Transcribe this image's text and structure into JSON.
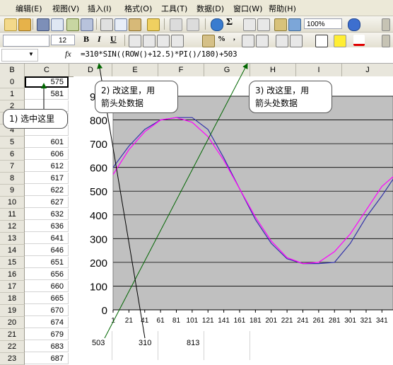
{
  "menu": [
    "编辑(E)",
    "视图(V)",
    "插入(I)",
    "格式(O)",
    "工具(T)",
    "数据(D)",
    "窗口(W)",
    "帮助(H)"
  ],
  "toolbar": {
    "zoom": "100%",
    "font_size": "12",
    "sigma": "Σ",
    "bold": "B",
    "italic": "I",
    "underline": "U",
    "percent": "%",
    "comma": ","
  },
  "formula_bar": {
    "fx": "fx",
    "formula": "=310*SIN((ROW()+12.5)*PI()/180)+503"
  },
  "columns": [
    "B",
    "C",
    "D",
    "E",
    "F",
    "G",
    "H",
    "I",
    "J"
  ],
  "rows": [
    {
      "num": "0",
      "c": "575"
    },
    {
      "num": "1",
      "c": "581"
    },
    {
      "num": "2",
      "c": ""
    },
    {
      "num": "3",
      "c": ""
    },
    {
      "num": "4",
      "c": ""
    },
    {
      "num": "5",
      "c": "601"
    },
    {
      "num": "6",
      "c": "606"
    },
    {
      "num": "7",
      "c": "612"
    },
    {
      "num": "8",
      "c": "617"
    },
    {
      "num": "9",
      "c": "622"
    },
    {
      "num": "10",
      "c": "627"
    },
    {
      "num": "11",
      "c": "632"
    },
    {
      "num": "12",
      "c": "636"
    },
    {
      "num": "13",
      "c": "641"
    },
    {
      "num": "14",
      "c": "646"
    },
    {
      "num": "15",
      "c": "651"
    },
    {
      "num": "16",
      "c": "656"
    },
    {
      "num": "17",
      "c": "660"
    },
    {
      "num": "18",
      "c": "665"
    },
    {
      "num": "19",
      "c": "670"
    },
    {
      "num": "20",
      "c": "674"
    },
    {
      "num": "21",
      "c": "679"
    },
    {
      "num": "22",
      "c": "683"
    },
    {
      "num": "23",
      "c": "687"
    }
  ],
  "bottom_cells": {
    "d22": "503",
    "e22": "310",
    "f22": "813"
  },
  "callouts": {
    "c1": "1) 选中这里",
    "c2_line1": "2) 改这里，用",
    "c2_line2": "箭头处数据",
    "c3_line1": "3) 改这里，用",
    "c3_line2": "箭头处数据"
  },
  "colors": {
    "plot_bg": "#c0c0c0",
    "series_blue": "#3333aa",
    "series_magenta": "#ff00ff",
    "arrow_green": "#006600"
  },
  "chart_data": {
    "type": "line",
    "ylim": [
      0,
      900
    ],
    "y_ticks": [
      "0",
      "100",
      "200",
      "300",
      "400",
      "500",
      "600",
      "700",
      "800",
      "900"
    ],
    "x_ticks": [
      "1",
      "21",
      "41",
      "61",
      "81",
      "101",
      "121",
      "141",
      "161",
      "181",
      "201",
      "221",
      "241",
      "261",
      "281",
      "301",
      "321",
      "341"
    ],
    "series": [
      {
        "color": "#3333aa",
        "x": [
          1,
          21,
          41,
          61,
          81,
          101,
          121,
          141,
          161,
          181,
          201,
          221,
          241,
          261,
          281,
          301,
          321,
          341,
          360
        ],
        "values": [
          600,
          690,
          760,
          800,
          810,
          810,
          760,
          640,
          510,
          380,
          280,
          215,
          195,
          195,
          200,
          280,
          390,
          480,
          575
        ]
      },
      {
        "color": "#ff00ff",
        "x": [
          1,
          21,
          41,
          61,
          81,
          101,
          121,
          141,
          161,
          181,
          201,
          221,
          241,
          261,
          281,
          301,
          321,
          341,
          360
        ],
        "values": [
          570,
          675,
          750,
          800,
          810,
          790,
          730,
          630,
          510,
          390,
          290,
          220,
          195,
          200,
          245,
          320,
          420,
          520,
          575
        ]
      }
    ]
  }
}
